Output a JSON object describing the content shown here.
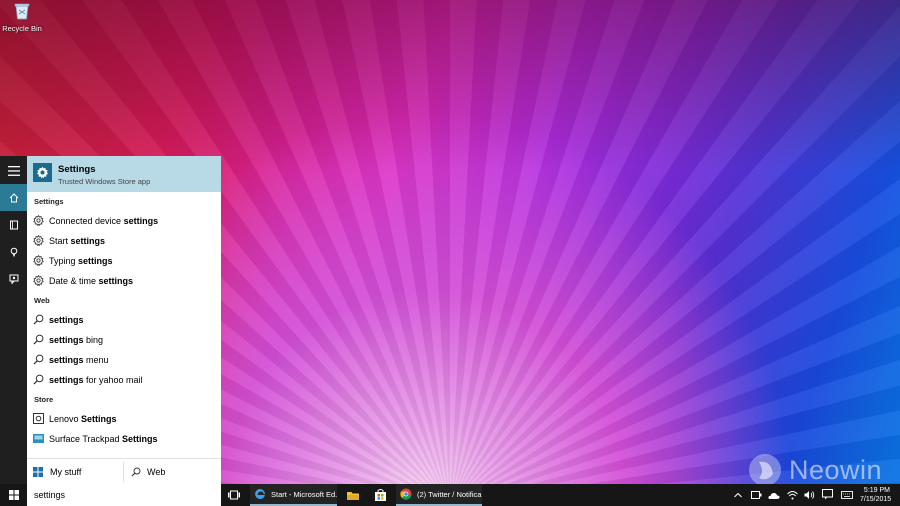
{
  "desktop": {
    "recycle_bin_label": "Recycle Bin",
    "watermark_text": "Neowin"
  },
  "colors": {
    "accent": "#2b7a96",
    "top_hit_bg": "#b8d9e6",
    "tile": "#1a6c8f",
    "taskbar": "#161616"
  },
  "rail": {
    "items": [
      {
        "icon": "hamburger-menu-icon"
      },
      {
        "icon": "home-icon",
        "active": true
      },
      {
        "icon": "notebook-icon"
      },
      {
        "icon": "reminders-icon"
      },
      {
        "icon": "feedback-icon"
      }
    ]
  },
  "search_panel": {
    "top_hit": {
      "title": "Settings",
      "subtitle": "Trusted Windows Store app",
      "icon": "gear-icon"
    },
    "sections": [
      {
        "heading": "Settings",
        "items": [
          {
            "pre": "Connected device ",
            "bold": "settings",
            "post": "",
            "icon": "gear-icon"
          },
          {
            "pre": "Start ",
            "bold": "settings",
            "post": "",
            "icon": "gear-icon"
          },
          {
            "pre": "Typing ",
            "bold": "settings",
            "post": "",
            "icon": "gear-icon"
          },
          {
            "pre": "Date & time ",
            "bold": "settings",
            "post": "",
            "icon": "gear-icon"
          }
        ]
      },
      {
        "heading": "Web",
        "items": [
          {
            "pre": "",
            "bold": "settings",
            "post": "",
            "icon": "search-icon"
          },
          {
            "pre": "",
            "bold": "settings",
            "post": " bing",
            "icon": "search-icon"
          },
          {
            "pre": "",
            "bold": "settings",
            "post": " menu",
            "icon": "search-icon"
          },
          {
            "pre": "",
            "bold": "settings",
            "post": " for yahoo mail",
            "icon": "search-icon"
          }
        ]
      },
      {
        "heading": "Store",
        "items": [
          {
            "pre": "Lenovo ",
            "bold": "Settings",
            "post": "",
            "icon": "lenovo-settings-icon"
          },
          {
            "pre": "Surface Trackpad ",
            "bold": "Settings",
            "post": "",
            "icon": "trackpad-icon"
          }
        ]
      }
    ],
    "bottom": {
      "my_stuff": "My stuff",
      "web": "Web"
    }
  },
  "taskbar": {
    "search_query": "settings",
    "apps": [
      {
        "label": "Start - Microsoft Ed...",
        "icon": "edge-icon",
        "running": true
      },
      {
        "label": "",
        "icon": "file-explorer-icon",
        "running": false
      },
      {
        "label": "",
        "icon": "store-icon",
        "running": false
      },
      {
        "label": "(2) Twitter / Notifica...",
        "icon": "chrome-icon",
        "running": true
      }
    ],
    "time": "5:19 PM",
    "date": "7/15/2015"
  }
}
